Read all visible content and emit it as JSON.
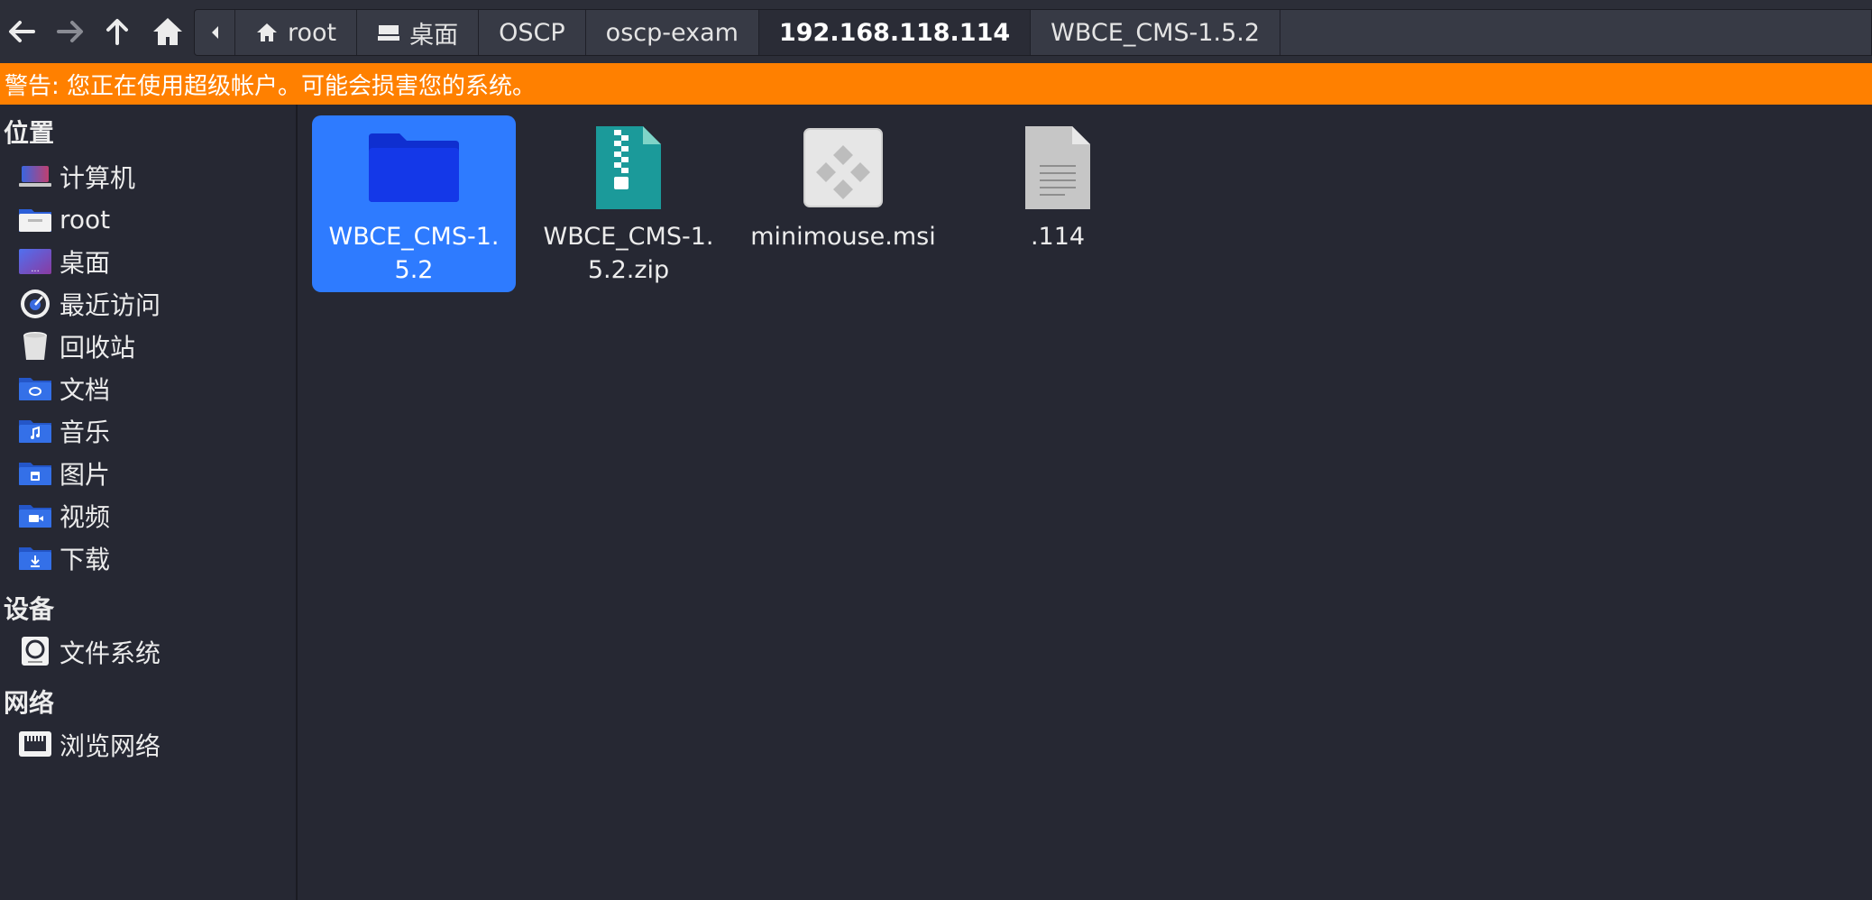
{
  "toolbar": {
    "breadcrumbs": [
      {
        "label": "root",
        "icon": "home-icon"
      },
      {
        "label": "桌面",
        "icon": "desktop-icon"
      },
      {
        "label": "OSCP"
      },
      {
        "label": "oscp-exam"
      },
      {
        "label": "192.168.118.114",
        "active": true
      },
      {
        "label": "WBCE_CMS-1.5.2"
      }
    ]
  },
  "warning": "警告: 您正在使用超级帐户。可能会损害您的系统。",
  "sidebar": {
    "places_title": "位置",
    "places": [
      {
        "label": "计算机",
        "icon": "computer-icon"
      },
      {
        "label": "root",
        "icon": "home-folder-icon"
      },
      {
        "label": "桌面",
        "icon": "desktop-icon"
      },
      {
        "label": "最近访问",
        "icon": "recent-icon"
      },
      {
        "label": "回收站",
        "icon": "trash-icon"
      },
      {
        "label": "文档",
        "icon": "documents-folder-icon"
      },
      {
        "label": "音乐",
        "icon": "music-folder-icon"
      },
      {
        "label": "图片",
        "icon": "pictures-folder-icon"
      },
      {
        "label": "视频",
        "icon": "videos-folder-icon"
      },
      {
        "label": "下载",
        "icon": "downloads-folder-icon"
      }
    ],
    "devices_title": "设备",
    "devices": [
      {
        "label": "文件系统",
        "icon": "drive-icon"
      }
    ],
    "network_title": "网络",
    "network": [
      {
        "label": "浏览网络",
        "icon": "network-icon"
      }
    ]
  },
  "files": [
    {
      "name": "WBCE_CMS-1.5.2",
      "icon": "folder-icon",
      "selected": true
    },
    {
      "name": "WBCE_CMS-1.5.2.zip",
      "icon": "zip-archive-icon"
    },
    {
      "name": "minimouse.msi",
      "icon": "msi-package-icon"
    },
    {
      "name": ".114",
      "icon": "text-file-icon"
    }
  ],
  "colors": {
    "background": "#262833",
    "warning": "#ff8000",
    "selection": "#2e7bff",
    "folder": "#1133dd"
  }
}
